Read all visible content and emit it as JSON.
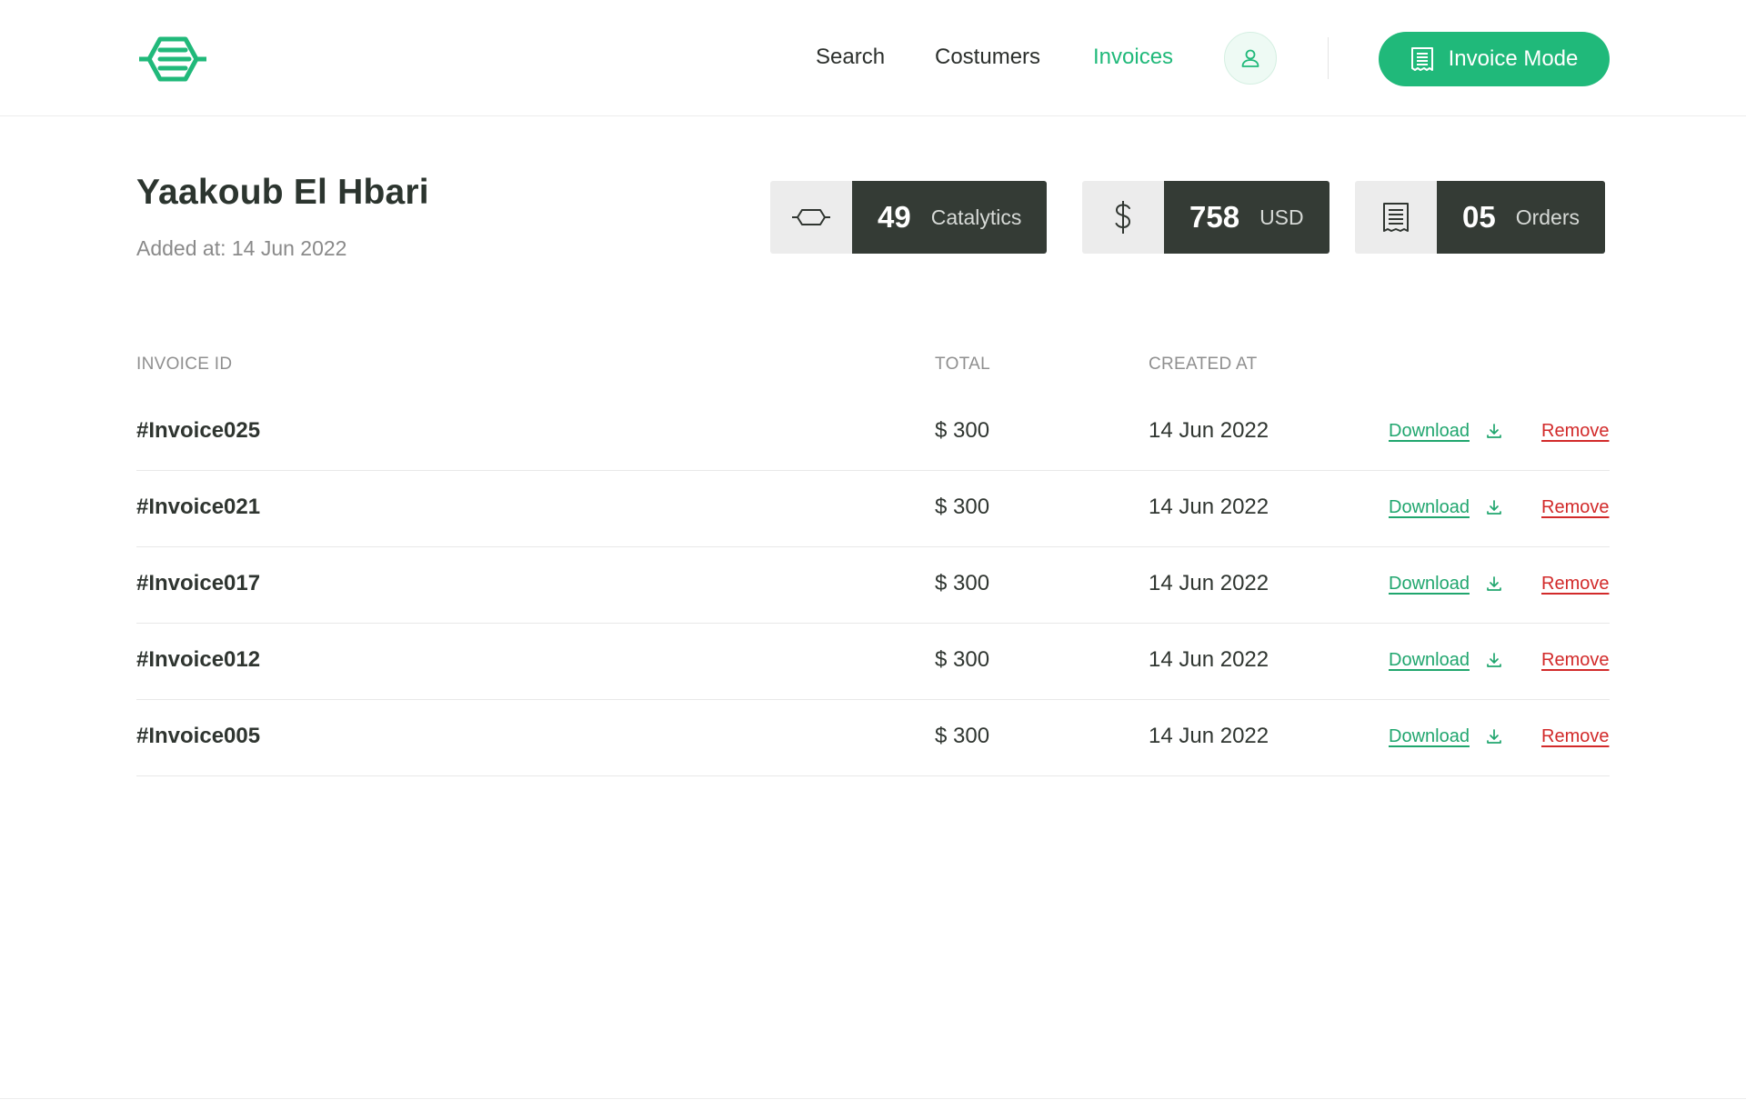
{
  "header": {
    "nav": [
      {
        "label": "Search"
      },
      {
        "label": "Costumers"
      },
      {
        "label": "Invoices"
      }
    ],
    "invoice_mode_label": "Invoice Mode"
  },
  "customer": {
    "name": "Yaakoub El Hbari",
    "added": "Added at: 14 Jun 2022"
  },
  "stats": [
    {
      "icon": "catalytic-converter-icon",
      "value": "49",
      "unit": "Catalytics"
    },
    {
      "icon": "dollar-icon",
      "value": "758",
      "unit": "USD"
    },
    {
      "icon": "receipt-icon",
      "value": "05",
      "unit": "Orders"
    }
  ],
  "table": {
    "headers": {
      "id": "INVOICE ID",
      "total": "TOTAL",
      "created": "CREATED AT"
    },
    "download_label": "Download",
    "remove_label": "Remove",
    "rows": [
      {
        "id": "#Invoice025",
        "total": "$ 300",
        "created": "14 Jun 2022"
      },
      {
        "id": "#Invoice021",
        "total": "$ 300",
        "created": "14 Jun 2022"
      },
      {
        "id": "#Invoice017",
        "total": "$ 300",
        "created": "14 Jun 2022"
      },
      {
        "id": "#Invoice012",
        "total": "$ 300",
        "created": "14 Jun 2022"
      },
      {
        "id": "#Invoice005",
        "total": "$ 300",
        "created": "14 Jun 2022"
      }
    ]
  },
  "colors": {
    "accent": "#20b97a",
    "danger": "#d22a2a",
    "dark": "#343b35"
  }
}
